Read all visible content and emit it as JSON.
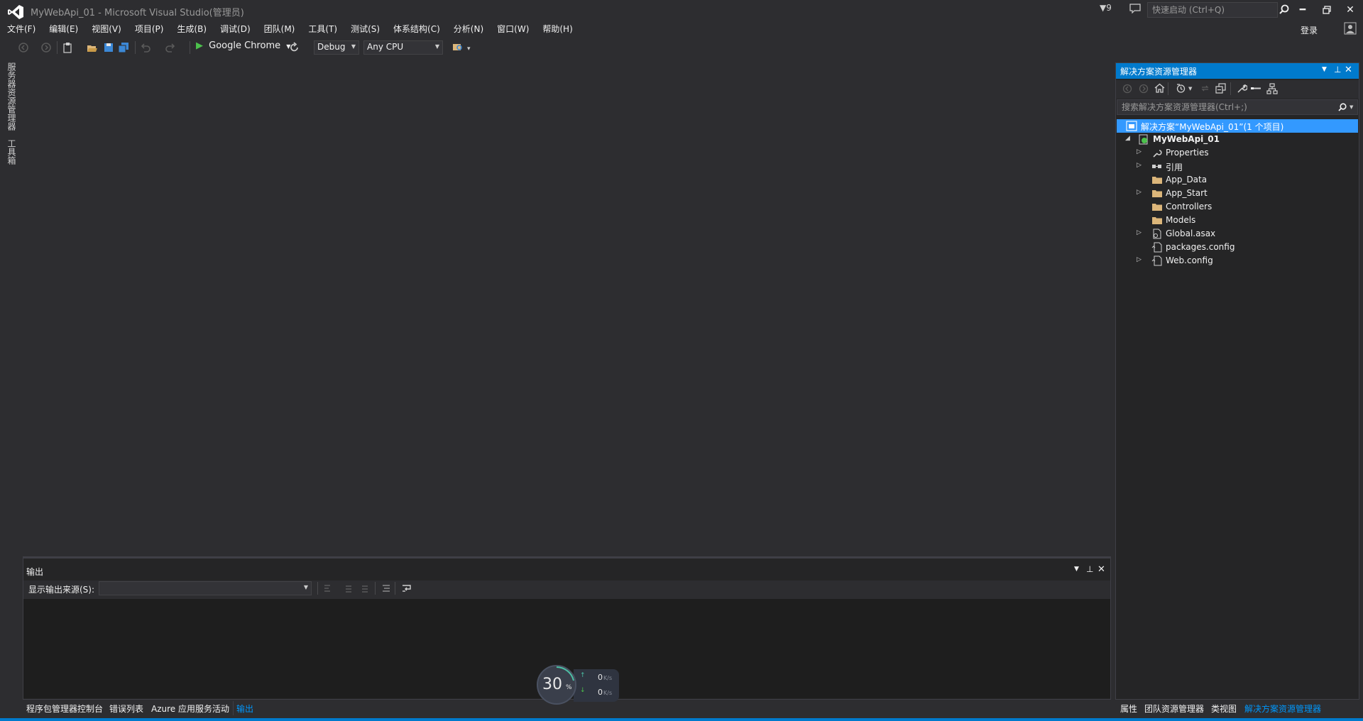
{
  "window": {
    "title": "MyWebApi_01 - Microsoft Visual Studio(管理员)",
    "notification_count": "9",
    "quick_launch_placeholder": "快速启动 (Ctrl+Q)",
    "login_label": "登录"
  },
  "menu": {
    "items": [
      "文件(F)",
      "编辑(E)",
      "视图(V)",
      "项目(P)",
      "生成(B)",
      "调试(D)",
      "团队(M)",
      "工具(T)",
      "测试(S)",
      "体系结构(C)",
      "分析(N)",
      "窗口(W)",
      "帮助(H)"
    ]
  },
  "toolbar": {
    "run_target": "Google Chrome",
    "configuration": "Debug",
    "platform": "Any CPU"
  },
  "left_strip": {
    "tabs": [
      "服务器资源管理器",
      "工具箱"
    ]
  },
  "output": {
    "title": "输出",
    "source_label": "显示输出来源(S):",
    "source_value": ""
  },
  "bottom_tabs_left": [
    "程序包管理器控制台",
    "错误列表",
    "Azure 应用服务活动",
    "输出"
  ],
  "bottom_tabs_right": [
    "属性",
    "团队资源管理器",
    "类视图",
    "解决方案资源管理器"
  ],
  "solution_explorer": {
    "title": "解决方案资源管理器",
    "search_placeholder": "搜索解决方案资源管理器(Ctrl+;)",
    "tree": [
      {
        "label": "解决方案“MyWebApi_01”(1 个项目)",
        "icon": "solution-icon",
        "level": 0,
        "expander": "none",
        "selected": true
      },
      {
        "label": "MyWebApi_01",
        "icon": "web-project-icon",
        "level": 1,
        "expander": "expanded",
        "bold": true
      },
      {
        "label": "Properties",
        "icon": "wrench-icon",
        "level": 2,
        "expander": "collapsed"
      },
      {
        "label": "引用",
        "icon": "references-icon",
        "level": 2,
        "expander": "collapsed"
      },
      {
        "label": "App_Data",
        "icon": "folder-icon",
        "level": 2,
        "expander": "none"
      },
      {
        "label": "App_Start",
        "icon": "folder-icon",
        "level": 2,
        "expander": "collapsed"
      },
      {
        "label": "Controllers",
        "icon": "folder-icon",
        "level": 2,
        "expander": "none"
      },
      {
        "label": "Models",
        "icon": "folder-icon",
        "level": 2,
        "expander": "none"
      },
      {
        "label": "Global.asax",
        "icon": "file-icon",
        "level": 2,
        "expander": "collapsed"
      },
      {
        "label": "packages.config",
        "icon": "config-file-icon",
        "level": 2,
        "expander": "none"
      },
      {
        "label": "Web.config",
        "icon": "config-file-icon",
        "level": 2,
        "expander": "collapsed"
      }
    ]
  },
  "speed_widget": {
    "percent": "30",
    "percent_symbol": "%",
    "upload_value": "0",
    "upload_unit": "K/s",
    "download_value": "0",
    "download_unit": "K/s"
  },
  "colors": {
    "accent": "#007acc",
    "selection": "#3399ff",
    "background": "#2d2d30",
    "folder": "#dcb67a"
  }
}
